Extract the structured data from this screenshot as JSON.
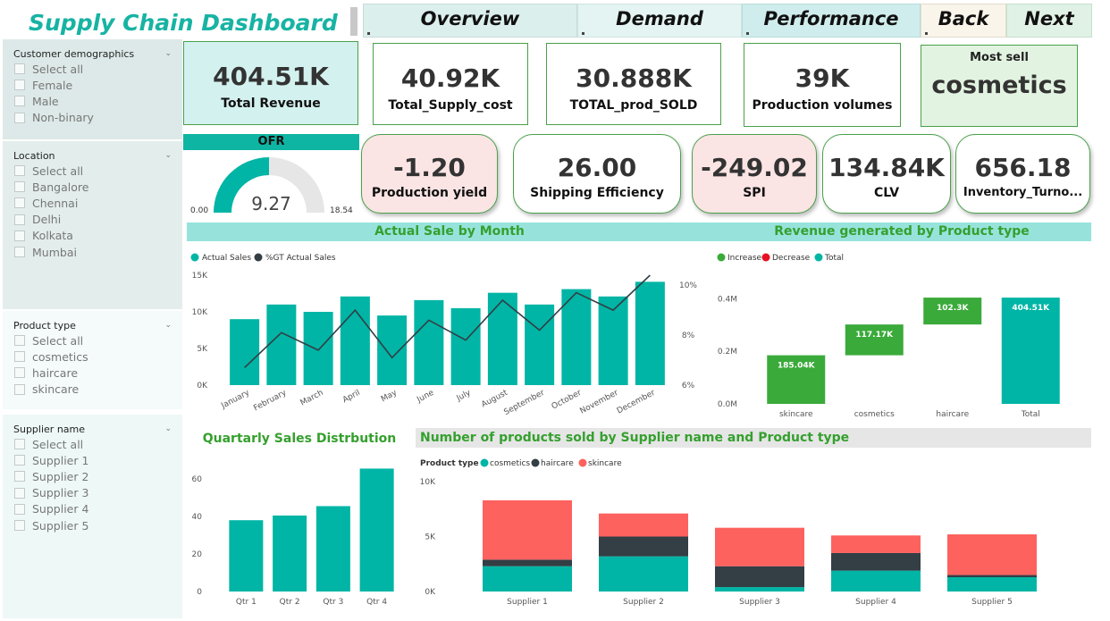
{
  "header": {
    "title": "Supply Chain Dashboard",
    "nav": [
      "Overview",
      "Demand",
      "Performance",
      "Back",
      "Next"
    ]
  },
  "sidebar": {
    "customer": {
      "title": "Customer demographics",
      "options": [
        "Select all",
        "Female",
        "Male",
        "Non-binary"
      ]
    },
    "location": {
      "title": "Location",
      "options": [
        "Select all",
        "Bangalore",
        "Chennai",
        "Delhi",
        "Kolkata",
        "Mumbai"
      ]
    },
    "product": {
      "title": "Product type",
      "options": [
        "Select all",
        "cosmetics",
        "haircare",
        "skincare"
      ]
    },
    "supplier": {
      "title": "Supplier name",
      "options": [
        "Select all",
        "Supplier 1",
        "Supplier 2",
        "Supplier 3",
        "Supplier 4",
        "Supplier 5"
      ]
    }
  },
  "kpis": {
    "revenue": {
      "value": "404.51K",
      "label": "Total Revenue"
    },
    "supply_cost": {
      "value": "40.92K",
      "label": "Total_Supply_cost"
    },
    "prod_sold": {
      "value": "30.888K",
      "label": "TOTAL_prod_SOLD"
    },
    "prod_volumes": {
      "value": "39K",
      "label": "Production volumes"
    },
    "most_sell": {
      "label": "Most sell",
      "value": "cosmetics"
    }
  },
  "ofr": {
    "title": "OFR",
    "value": "9.27",
    "min": "0.00",
    "max": "18.54",
    "fill_fraction": 0.5
  },
  "pills": {
    "yield": {
      "value": "-1.20",
      "label": "Production yield"
    },
    "shipping": {
      "value": "26.00",
      "label": "Shipping Efficiency"
    },
    "spi": {
      "value": "-249.02",
      "label": "SPI"
    },
    "clv": {
      "value": "134.84K",
      "label": "CLV"
    },
    "inventory": {
      "value": "656.18",
      "label": "Inventory_Turno..."
    }
  },
  "colors": {
    "teal": "#00b5a5",
    "dark": "#333e45",
    "red": "#fd625e",
    "green": "#3aaa3a",
    "pink": "#fbe4e4",
    "kpi_bg": "#d3f1ef"
  },
  "chart_data": [
    {
      "type": "bar",
      "title": "Actual Sale by Month",
      "legend": [
        "Actual Sales",
        "%GT Actual Sales"
      ],
      "categories": [
        "January",
        "February",
        "March",
        "April",
        "May",
        "June",
        "July",
        "August",
        "September",
        "October",
        "November",
        "December"
      ],
      "series": [
        {
          "name": "Actual Sales",
          "values": [
            9000,
            11000,
            10000,
            12100,
            9500,
            11600,
            10500,
            12600,
            11000,
            13100,
            12100,
            14100
          ]
        },
        {
          "name": "%GT Actual Sales",
          "values": [
            6.7,
            8.1,
            7.4,
            9.0,
            7.1,
            8.6,
            7.8,
            9.4,
            8.2,
            9.7,
            9.0,
            10.4
          ]
        }
      ],
      "y_ticks": [
        "0K",
        "5K",
        "10K",
        "15K"
      ],
      "y2_ticks": [
        "6%",
        "8%",
        "10%"
      ],
      "ylim": [
        0,
        15000
      ],
      "y2lim": [
        6,
        10.4
      ]
    },
    {
      "type": "waterfall",
      "title": "Revenue generated by Product type",
      "legend": [
        "Increase",
        "Decrease",
        "Total"
      ],
      "categories": [
        "skincare",
        "cosmetics",
        "haircare",
        "Total"
      ],
      "values": [
        185040,
        117170,
        102300,
        404510
      ],
      "labels": [
        "185.04K",
        "117.17K",
        "102.3K",
        "404.51K"
      ],
      "y_ticks": [
        "0.0M",
        "0.2M",
        "0.4M"
      ],
      "ylim": [
        0,
        500000
      ]
    },
    {
      "type": "bar",
      "title": "Quartarly Sales Distrbution",
      "categories": [
        "Qtr 1",
        "Qtr 2",
        "Qtr 3",
        "Qtr 4"
      ],
      "values": [
        38,
        40.5,
        45.5,
        65.5
      ],
      "y_ticks": [
        "0",
        "20",
        "40",
        "60"
      ],
      "ylim": [
        0,
        70
      ]
    },
    {
      "type": "bar",
      "title": "Number of products sold by Supplier name and Product type",
      "legend_title": "Product type",
      "categories": [
        "Supplier 1",
        "Supplier 2",
        "Supplier 3",
        "Supplier 4",
        "Supplier 5"
      ],
      "series": [
        {
          "name": "cosmetics",
          "values": [
            2300,
            3200,
            400,
            1900,
            1300
          ]
        },
        {
          "name": "haircare",
          "values": [
            600,
            1800,
            1900,
            1600,
            200
          ]
        },
        {
          "name": "skincare",
          "values": [
            5400,
            2100,
            3500,
            1600,
            3700
          ]
        }
      ],
      "y_ticks": [
        "0K",
        "5K",
        "10K"
      ],
      "ylim": [
        0,
        10000
      ]
    }
  ]
}
